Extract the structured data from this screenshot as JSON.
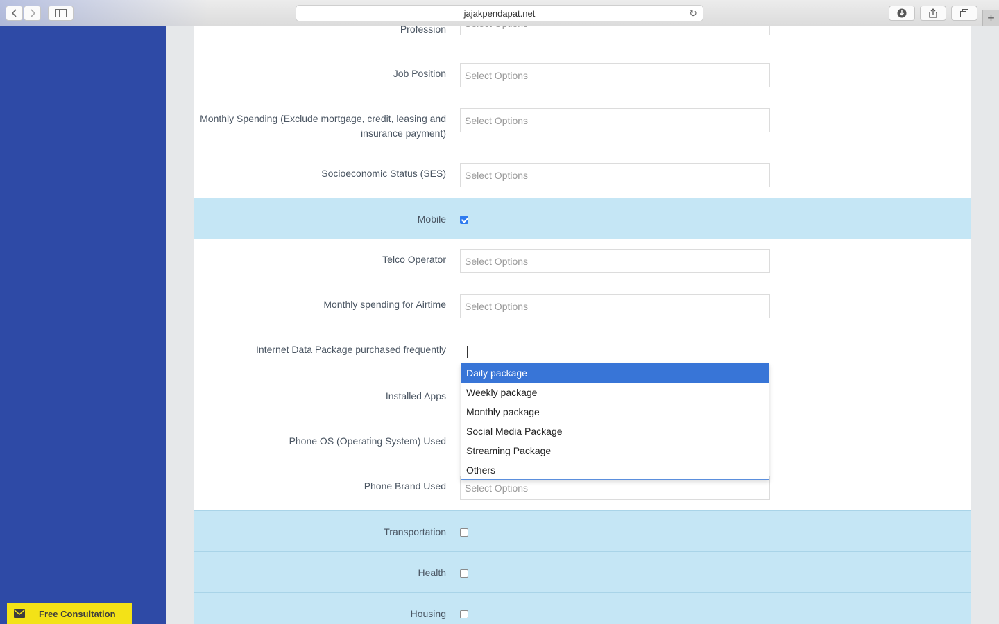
{
  "browser": {
    "url": "jajakpendapat.net"
  },
  "select_placeholder": "Select Options",
  "fields": {
    "profession": "Profession",
    "job_position": "Job Position",
    "monthly_spending": "Monthly Spending (Exclude mortgage, credit, leasing and insurance payment)",
    "ses": "Socioeconomic Status (SES)",
    "mobile": "Mobile",
    "telco_operator": "Telco Operator",
    "airtime": "Monthly spending for Airtime",
    "internet_package": "Internet Data Package purchased frequently",
    "installed_apps": "Installed Apps",
    "phone_os": "Phone OS (Operating System) Used",
    "phone_brand": "Phone Brand Used",
    "transportation": "Transportation",
    "health": "Health",
    "housing": "Housing"
  },
  "dropdown": {
    "options": [
      "Daily package",
      "Weekly package",
      "Monthly package",
      "Social Media Package",
      "Streaming Package",
      "Others"
    ],
    "highlighted": "Daily package"
  },
  "consultation": {
    "label": "Free Consultation"
  },
  "colors": {
    "sidebar": "#2e4aa6",
    "section": "#c5e6f5",
    "highlight": "#3875d7",
    "consult": "#f3e217"
  }
}
